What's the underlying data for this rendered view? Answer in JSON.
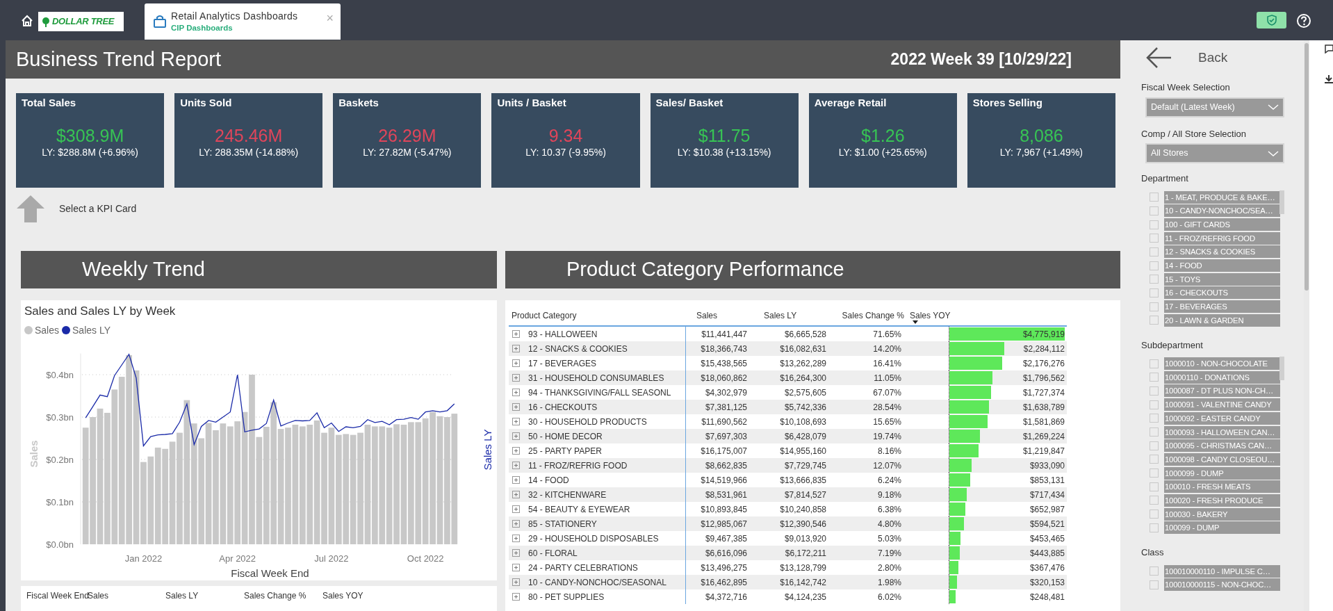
{
  "topbar": {
    "logo_text": "DOLLAR TREE",
    "tab": {
      "title": "Retail Analytics Dashboards",
      "subtitle": "CIP Dashboards",
      "close": "×"
    }
  },
  "report": {
    "title": "Business Trend Report",
    "period": "2022 Week 39 [10/29/22]"
  },
  "kpi_cards": [
    {
      "label": "Total Sales",
      "value": "$308.9M",
      "ly": "LY: $288.8M (+6.96%)",
      "positive": true
    },
    {
      "label": "Units Sold",
      "value": "245.46M",
      "ly": "LY: 288.35M (-14.88%)",
      "positive": false
    },
    {
      "label": "Baskets",
      "value": "26.29M",
      "ly": "LY: 27.82M (-5.47%)",
      "positive": false
    },
    {
      "label": "Units / Basket",
      "value": "9.34",
      "ly": "LY: 10.37 (-9.95%)",
      "positive": false
    },
    {
      "label": "Sales/ Basket",
      "value": "$11.75",
      "ly": "LY: $10.38 (+13.15%)",
      "positive": true
    },
    {
      "label": "Average Retail",
      "value": "$1.26",
      "ly": "LY: $1.00 (+25.65%)",
      "positive": true
    },
    {
      "label": "Stores Selling",
      "value": "8,086",
      "ly": "LY: 7,967 (+1.49%)",
      "positive": true
    }
  ],
  "kpi_hint": "Select a KPI Card",
  "weekly_trend": {
    "heading": "Weekly Trend",
    "chart_data": {
      "type": "bar",
      "title": "Sales and Sales LY by Week",
      "xlabel": "Fiscal Week End",
      "ylabel": "Sales",
      "y2label": "Sales LY",
      "categories": [
        null,
        null,
        null,
        null,
        null,
        null,
        null,
        null,
        "Jan 2022",
        null,
        null,
        null,
        null,
        null,
        null,
        null,
        null,
        null,
        null,
        null,
        null,
        "Apr 2022",
        null,
        null,
        null,
        null,
        null,
        null,
        null,
        null,
        null,
        null,
        null,
        null,
        "Jul 2022",
        null,
        null,
        null,
        null,
        null,
        null,
        null,
        null,
        null,
        null,
        null,
        null,
        "Oct 2022",
        null,
        null,
        null,
        null
      ],
      "series": [
        {
          "name": "Sales",
          "type": "bar",
          "color": "#c8c8c8",
          "values": [
            0.275,
            0.3,
            0.32,
            0.31,
            0.365,
            0.395,
            0.446,
            0.41,
            0.194,
            0.207,
            0.228,
            0.225,
            0.242,
            0.263,
            0.34,
            0.285,
            0.25,
            0.286,
            0.269,
            0.285,
            0.278,
            0.29,
            0.312,
            0.4,
            0.253,
            0.277,
            0.335,
            0.272,
            0.275,
            0.282,
            0.278,
            0.282,
            0.292,
            0.263,
            0.275,
            0.258,
            0.26,
            0.258,
            0.263,
            0.282,
            0.278,
            0.278,
            0.275,
            0.283,
            0.282,
            0.288,
            0.288,
            0.297,
            0.312,
            0.302,
            0.3,
            0.308
          ]
        },
        {
          "name": "Sales LY",
          "type": "line",
          "color": "#1a2aa8",
          "values": [
            0.298,
            0.325,
            0.352,
            0.348,
            0.398,
            0.423,
            0.448,
            0.392,
            0.232,
            0.254,
            0.258,
            0.259,
            0.261,
            0.288,
            0.331,
            0.235,
            0.278,
            0.292,
            0.288,
            0.3,
            0.312,
            0.4,
            0.265,
            0.269,
            0.272,
            0.285,
            0.34,
            0.279,
            0.286,
            0.292,
            0.291,
            0.292,
            0.31,
            0.275,
            0.286,
            0.266,
            0.277,
            0.275,
            0.278,
            0.294,
            0.287,
            0.29,
            0.282,
            0.294,
            0.295,
            0.299,
            0.295,
            0.312,
            0.315,
            0.312,
            0.315,
            0.331
          ]
        }
      ],
      "grid": true,
      "ylim": [
        0,
        0.45
      ],
      "yticks": [
        {
          "value": 0,
          "label": "$0.0bn"
        },
        {
          "value": 0.1,
          "label": "$0.1bn"
        },
        {
          "value": 0.2,
          "label": "$0.2bn"
        },
        {
          "value": 0.3,
          "label": "$0.3bn"
        },
        {
          "value": 0.4,
          "label": "$0.4bn"
        }
      ]
    },
    "table": {
      "columns": [
        "Fiscal Week End",
        "Sales",
        "Sales LY",
        "Sales Change %",
        "Sales YOY"
      ]
    }
  },
  "category_performance": {
    "heading": "Product Category Performance",
    "columns": [
      {
        "label": "Product Category",
        "sorted": false
      },
      {
        "label": "Sales",
        "sorted": false
      },
      {
        "label": "Sales LY",
        "sorted": false
      },
      {
        "label": "Sales Change %",
        "sorted": false
      },
      {
        "label": "Sales YOY",
        "sorted": true
      }
    ],
    "rows": [
      {
        "category": "93 - HALLOWEEN",
        "sales": "$11,441,447",
        "sales_ly": "$6,665,528",
        "change": "71.65%",
        "yoy": "$4,775,919",
        "level": 1.0
      },
      {
        "category": "12 - SNACKS & COOKIES",
        "sales": "$18,366,743",
        "sales_ly": "$16,082,631",
        "change": "14.20%",
        "yoy": "$2,284,112",
        "level": 0.478
      },
      {
        "category": "17 - BEVERAGES",
        "sales": "$15,438,565",
        "sales_ly": "$13,262,289",
        "change": "16.41%",
        "yoy": "$2,176,276",
        "level": 0.456
      },
      {
        "category": "31 - HOUSEHOLD CONSUMABLES",
        "sales": "$18,060,862",
        "sales_ly": "$16,264,300",
        "change": "11.05%",
        "yoy": "$1,796,562",
        "level": 0.376
      },
      {
        "category": "94 - THANKSGIVING/FALL SEASONL",
        "sales": "$4,302,979",
        "sales_ly": "$2,575,605",
        "change": "67.07%",
        "yoy": "$1,727,374",
        "level": 0.362
      },
      {
        "category": "16 - CHECKOUTS",
        "sales": "$7,381,125",
        "sales_ly": "$5,742,336",
        "change": "28.54%",
        "yoy": "$1,638,789",
        "level": 0.343
      },
      {
        "category": "30 - HOUSEHOLD PRODUCTS",
        "sales": "$11,690,562",
        "sales_ly": "$10,108,693",
        "change": "15.65%",
        "yoy": "$1,581,869",
        "level": 0.331
      },
      {
        "category": "50 - HOME DECOR",
        "sales": "$7,697,303",
        "sales_ly": "$6,428,079",
        "change": "19.74%",
        "yoy": "$1,269,224",
        "level": 0.266
      },
      {
        "category": "25 - PARTY PAPER",
        "sales": "$16,175,007",
        "sales_ly": "$14,955,160",
        "change": "8.16%",
        "yoy": "$1,219,847",
        "level": 0.255
      },
      {
        "category": "11 - FROZ/REFRIG FOOD",
        "sales": "$8,662,835",
        "sales_ly": "$7,729,745",
        "change": "12.07%",
        "yoy": "$933,090",
        "level": 0.195
      },
      {
        "category": "14 - FOOD",
        "sales": "$14,519,966",
        "sales_ly": "$13,666,835",
        "change": "6.24%",
        "yoy": "$853,131",
        "level": 0.179
      },
      {
        "category": "32 - KITCHENWARE",
        "sales": "$8,531,961",
        "sales_ly": "$7,814,527",
        "change": "9.18%",
        "yoy": "$717,434",
        "level": 0.15
      },
      {
        "category": "54 - BEAUTY & EYEWEAR",
        "sales": "$10,893,845",
        "sales_ly": "$10,240,858",
        "change": "6.38%",
        "yoy": "$652,987",
        "level": 0.137
      },
      {
        "category": "85 - STATIONERY",
        "sales": "$12,985,067",
        "sales_ly": "$12,390,546",
        "change": "4.80%",
        "yoy": "$594,521",
        "level": 0.124
      },
      {
        "category": "29 - HOUSEHOLD DISPOSABLES",
        "sales": "$9,467,385",
        "sales_ly": "$9,013,920",
        "change": "5.03%",
        "yoy": "$453,465",
        "level": 0.095
      },
      {
        "category": "60 - FLORAL",
        "sales": "$6,616,096",
        "sales_ly": "$6,172,211",
        "change": "7.19%",
        "yoy": "$443,885",
        "level": 0.093
      },
      {
        "category": "24 - PARTY CELEBRATIONS",
        "sales": "$13,496,275",
        "sales_ly": "$13,128,799",
        "change": "2.80%",
        "yoy": "$367,476",
        "level": 0.077
      },
      {
        "category": "10 - CANDY-NONCHOC/SEASONAL",
        "sales": "$16,462,895",
        "sales_ly": "$16,142,742",
        "change": "1.98%",
        "yoy": "$320,153",
        "level": 0.067
      },
      {
        "category": "80 - PET SUPPLIES",
        "sales": "$4,372,716",
        "sales_ly": "$4,124,235",
        "change": "6.02%",
        "yoy": "$248,481",
        "level": 0.052
      }
    ]
  },
  "sidebar": {
    "back": "Back",
    "filters": [
      {
        "label": "Fiscal Week Selection",
        "kind": "dropdown",
        "value": "Default (Latest Week)"
      },
      {
        "label": "Comp / All Store Selection",
        "kind": "dropdown",
        "value": "All Stores"
      },
      {
        "label": "Department",
        "kind": "list",
        "items": [
          {
            "label": "1 - MEAT, PRODUCE & BAKE…",
            "checked": false
          },
          {
            "label": "10 - CANDY-NONCHOC/SEA…",
            "checked": false
          },
          {
            "label": "100 - GIFT CARDS",
            "checked": false
          },
          {
            "label": "11 - FROZ/REFRIG FOOD",
            "checked": false
          },
          {
            "label": "12 - SNACKS & COOKIES",
            "checked": false
          },
          {
            "label": "14 - FOOD",
            "checked": false
          },
          {
            "label": "15 - TOYS",
            "checked": false
          },
          {
            "label": "16 - CHECKOUTS",
            "checked": false
          },
          {
            "label": "17 - BEVERAGES",
            "checked": false
          },
          {
            "label": "20 - LAWN & GARDEN",
            "checked": false
          }
        ]
      },
      {
        "label": "Subdepartment",
        "kind": "list",
        "items": [
          {
            "label": "1000010 - NON-CHOCOLATE",
            "checked": false
          },
          {
            "label": "10000110 - DONATIONS",
            "checked": false
          },
          {
            "label": "1000087 - DT PLUS NON-CH…",
            "checked": false
          },
          {
            "label": "1000091 - VALENTINE CANDY",
            "checked": false
          },
          {
            "label": "1000092 - EASTER CANDY",
            "checked": false
          },
          {
            "label": "1000093 - HALLOWEEN CAN…",
            "checked": false
          },
          {
            "label": "1000095 - CHRISTMAS CAN…",
            "checked": false
          },
          {
            "label": "1000098 - CANDY CLOSEOU…",
            "checked": false
          },
          {
            "label": "1000099 - DUMP",
            "checked": false
          },
          {
            "label": "100010 - FRESH MEATS",
            "checked": false
          },
          {
            "label": "100020 - FRESH PRODUCE",
            "checked": false
          },
          {
            "label": "100030 - BAKERY",
            "checked": false
          },
          {
            "label": "100099 - DUMP",
            "checked": false
          }
        ]
      },
      {
        "label": "Class",
        "kind": "list",
        "items": [
          {
            "label": "100010000110 - IMPULSE C…",
            "checked": false
          },
          {
            "label": "100010000115 - NON-CHOC…",
            "checked": false
          }
        ]
      }
    ]
  }
}
